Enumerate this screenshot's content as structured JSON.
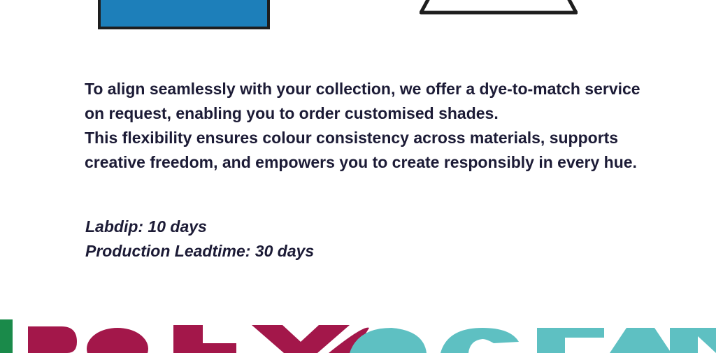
{
  "body": {
    "lines": [
      "To align seamlessly with your collection, we offer a dye-to-match service",
      "on request, enabling you to order customised shades.",
      "This flexibility ensures colour consistency across materials, supports",
      "creative freedom, and empowers you to create responsibly in every hue."
    ]
  },
  "lead_times": {
    "labdip": "Labdip: 10 days",
    "production": "Production Leadtime: 30 days"
  },
  "logo": {
    "name": "POLYOCEAN",
    "colors": {
      "green": "#1a8a4a",
      "maroon": "#a3174a",
      "teal": "#5ec0c2"
    }
  },
  "illustrations": {
    "box_color": "#1d7fba",
    "outline_color": "#1e1e1e"
  }
}
